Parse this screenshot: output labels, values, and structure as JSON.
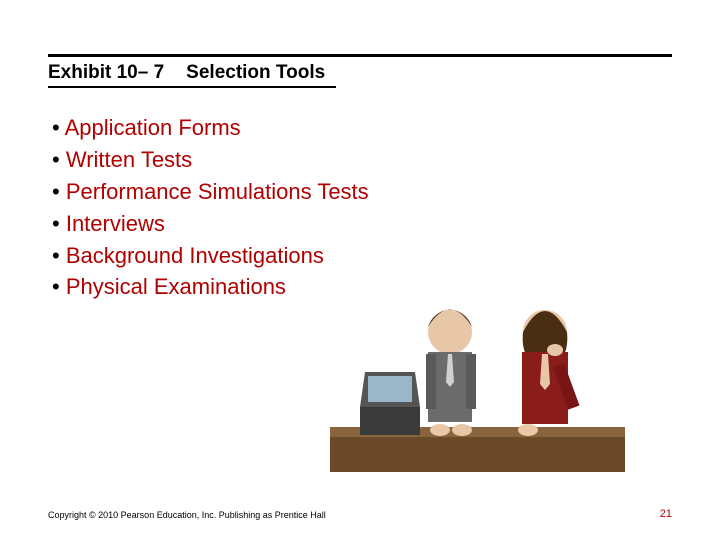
{
  "title": {
    "exhibit": "Exhibit 10– 7",
    "heading": "Selection Tools"
  },
  "bullets": [
    "Application Forms",
    "Written Tests",
    "Performance Simulations Tests",
    "Interviews",
    "Background Investigations",
    "Physical Examinations"
  ],
  "footer": {
    "copyright": "Copyright © 2010 Pearson Education, Inc. Publishing as Prentice Hall",
    "page": "21"
  },
  "illustration": {
    "description": "interview-clipart"
  }
}
